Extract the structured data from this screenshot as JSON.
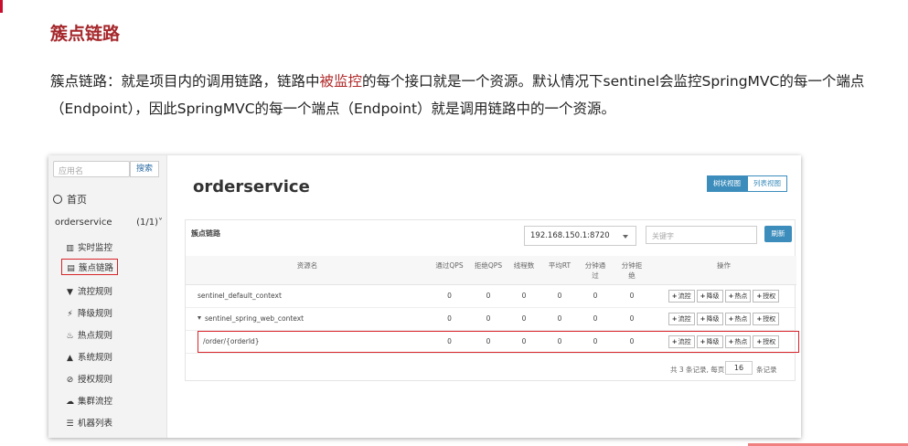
{
  "doc": {
    "title": "簇点链路",
    "para_part1": "簇点链路：就是项目内的调用链路，链路中",
    "para_highlight": "被监控",
    "para_part2": "的每个接口就是一个资源。默认情况下sentinel会监控SpringMVC的每一个端点（Endpoint），因此SpringMVC的每一个端点（Endpoint）就是调用链路中的一个资源。",
    "highlight_color": "#b02a2a",
    "title_color": "#a5282c"
  },
  "sidebar": {
    "search_placeholder": "应用名",
    "search_button": "搜索",
    "home_label": "首页",
    "app_name": "orderservice",
    "app_count": "(1/1)",
    "items": [
      {
        "label": "实时监控",
        "icon": "bar-chart-icon",
        "glyph": "▥"
      },
      {
        "label": "簇点链路",
        "icon": "list-icon",
        "glyph": "▤"
      },
      {
        "label": "流控规则",
        "icon": "filter-icon",
        "glyph": "▼"
      },
      {
        "label": "降级规则",
        "icon": "flash-icon",
        "glyph": "⚡"
      },
      {
        "label": "热点规则",
        "icon": "fire-icon",
        "glyph": "♨"
      },
      {
        "label": "系统规则",
        "icon": "lock-icon",
        "glyph": "▲"
      },
      {
        "label": "授权规则",
        "icon": "check-circle-icon",
        "glyph": "⊘"
      },
      {
        "label": "集群流控",
        "icon": "cloud-icon",
        "glyph": "☁"
      },
      {
        "label": "机器列表",
        "icon": "list-bullets-icon",
        "glyph": "☰"
      }
    ]
  },
  "main": {
    "app_title": "orderservice",
    "view_tree": "树状视图",
    "view_list": "列表视图",
    "panel_title": "簇点链路",
    "machine": "192.168.150.1:8720",
    "keyword_placeholder": "关键字",
    "refresh": "刷新",
    "columns": [
      "资源名",
      "通过QPS",
      "拒绝QPS",
      "线程数",
      "平均RT",
      "分钟通\n过",
      "分钟拒\n绝",
      "操作"
    ],
    "rows": [
      {
        "name": "sentinel_default_context",
        "values": [
          "0",
          "0",
          "0",
          "0",
          "0",
          "0"
        ]
      },
      {
        "name": "sentinel_spring_web_context",
        "values": [
          "0",
          "0",
          "0",
          "0",
          "0",
          "0"
        ]
      },
      {
        "name": "/order/{orderId}",
        "values": [
          "0",
          "0",
          "0",
          "0",
          "0",
          "0"
        ]
      }
    ],
    "ops": [
      "流控",
      "降级",
      "热点",
      "授权"
    ],
    "pager_text1": "共 3 条记录, 每页",
    "page_size": "16",
    "pager_text2": "条记录",
    "accent_color": "#3c8dbc"
  }
}
